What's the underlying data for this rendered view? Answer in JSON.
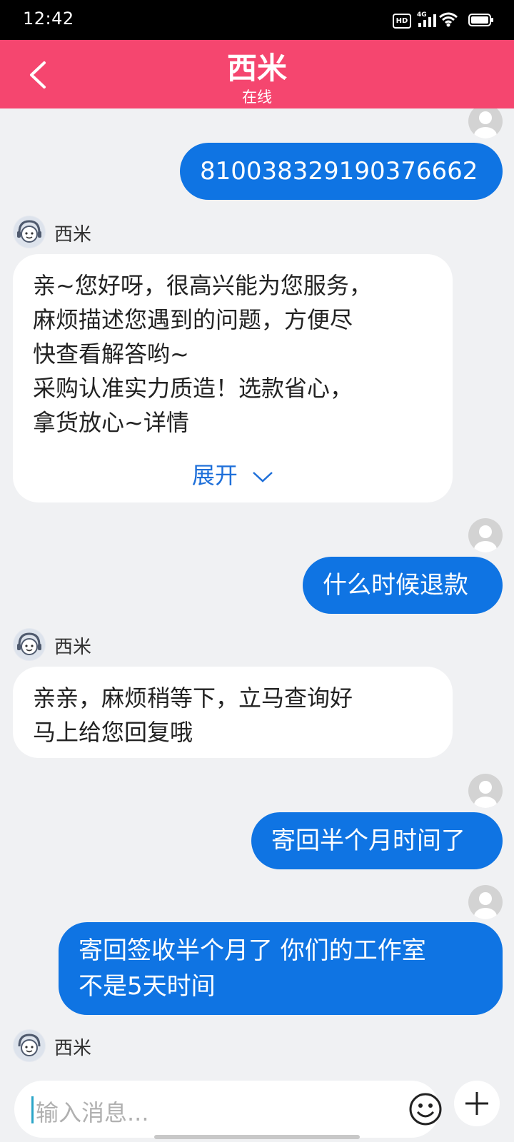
{
  "status_bar": {
    "time": "12:42",
    "hd_badge": "HD",
    "network": "4G",
    "icons": [
      "signal-icon",
      "wifi-icon",
      "battery-icon"
    ]
  },
  "header": {
    "title": "西米",
    "subtitle": "在线",
    "back_icon": "chevron-left-icon",
    "background_color": "#f5466f"
  },
  "messages": [
    {
      "sender": "user",
      "text": "810038329190376662"
    },
    {
      "sender": "agent",
      "name": "西米",
      "lines": [
        "亲~您好呀，很高兴能为您服务，",
        "麻烦描述您遇到的问题，方便尽",
        "快查看解答哟~",
        "采购认准实力质造！选款省心，",
        "拿货放心~详情"
      ],
      "expand_label": "展开"
    },
    {
      "sender": "user",
      "text": "什么时候退款"
    },
    {
      "sender": "agent",
      "name": "西米",
      "lines": [
        "亲亲，麻烦稍等下，立马查询好",
        "马上给您回复哦"
      ]
    },
    {
      "sender": "user",
      "text": "寄回半个月时间了"
    },
    {
      "sender": "user",
      "lines": [
        "寄回签收半个月了  你们的工作室",
        "不是5天时间"
      ]
    },
    {
      "sender": "agent",
      "name": "西米",
      "partial": true
    }
  ],
  "composer": {
    "placeholder": "输入消息...",
    "emoji_icon": "smiley-icon",
    "plus_icon": "plus-icon"
  },
  "colors": {
    "outgoing_bubble": "#0f74e3",
    "incoming_bubble": "#ffffff",
    "chat_background": "#f0f1f3",
    "expand_link": "#1e6fd9"
  }
}
